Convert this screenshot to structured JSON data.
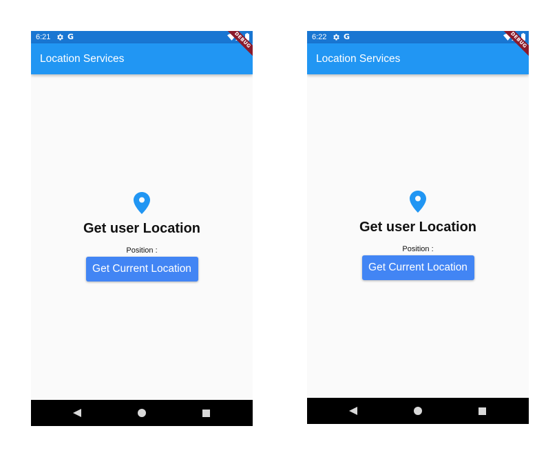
{
  "screens": [
    {
      "status_time": "6:21",
      "status_g": "G",
      "debug_banner": "DEBUG",
      "app_title": "Location Services",
      "heading": "Get user Location",
      "position_label": "Position :",
      "button_label": "Get Current Location"
    },
    {
      "status_time": "6:22",
      "status_g": "G",
      "debug_banner": "DEBUG",
      "app_title": "Location Services",
      "heading": "Get user Location",
      "position_label": "Position :",
      "button_label": "Get Current Location"
    }
  ],
  "icons": {
    "status": [
      "gear-icon",
      "wifi-icon",
      "signal-icon",
      "battery-icon"
    ],
    "content": "location-pin-icon",
    "nav": [
      "back-icon",
      "home-icon",
      "recents-icon"
    ]
  },
  "colors": {
    "status_bar": "#1976d2",
    "app_bar": "#2196f3",
    "button": "#4285f4",
    "pin": "#2196f3",
    "debug_banner": "#8b1a2b",
    "background": "#fafafa",
    "nav_bar": "#000000"
  }
}
